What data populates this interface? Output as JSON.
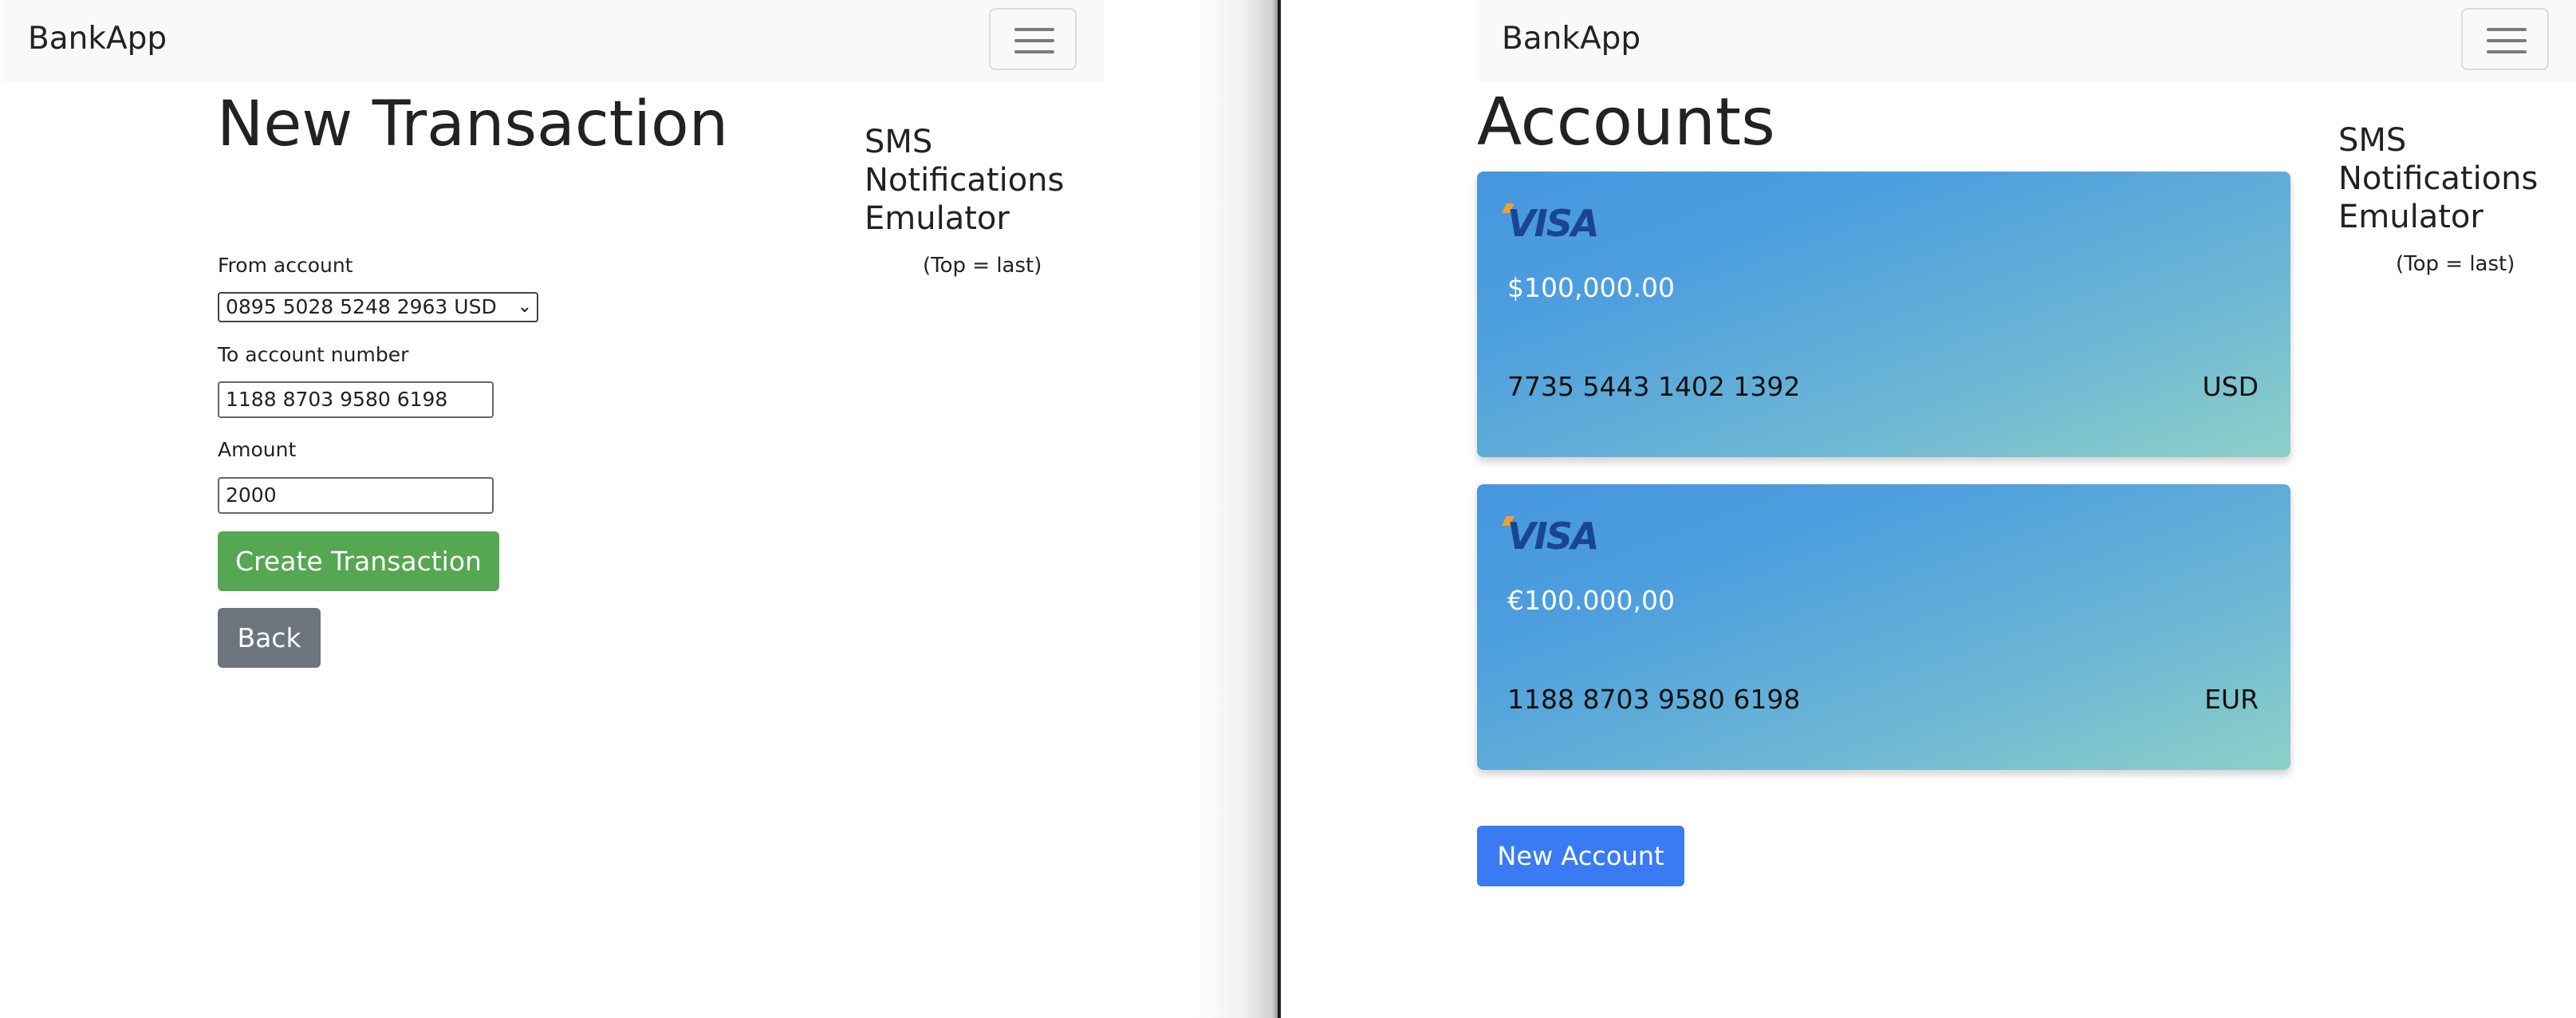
{
  "left_window": {
    "navbar": {
      "brand": "BankApp",
      "toggler_icon": "hamburger-icon"
    },
    "page_title": "New Transaction",
    "form": {
      "from_label": "From account",
      "from_value": "0895 5028 5248 2963 USD",
      "to_label": "To account number",
      "to_value": "1188 8703 9580 6198",
      "amount_label": "Amount",
      "amount_value": "2000",
      "submit_label": "Create Transaction",
      "back_label": "Back"
    },
    "sms": {
      "title": "SMS Notifications Emulator",
      "subtitle": "(Top = last)"
    }
  },
  "right_window": {
    "navbar": {
      "brand": "BankApp",
      "toggler_icon": "hamburger-icon"
    },
    "page_title": "Accounts",
    "accounts": [
      {
        "brand": "VISA",
        "balance": "$100,000.00",
        "number": "7735 5443 1402 1392",
        "currency": "USD"
      },
      {
        "brand": "VISA",
        "balance": "€100.000,00",
        "number": "1188 8703 9580 6198",
        "currency": "EUR"
      }
    ],
    "new_account_label": "New Account",
    "sms": {
      "title": "SMS Notifications Emulator",
      "subtitle": "(Top = last)"
    }
  },
  "colors": {
    "success": "#55a751",
    "secondary": "#6c757d",
    "primary": "#3a7bf4",
    "navbar_bg": "#f8f9fa",
    "card_gradient_start": "#4596e0",
    "card_gradient_end": "#8ed0c8"
  }
}
